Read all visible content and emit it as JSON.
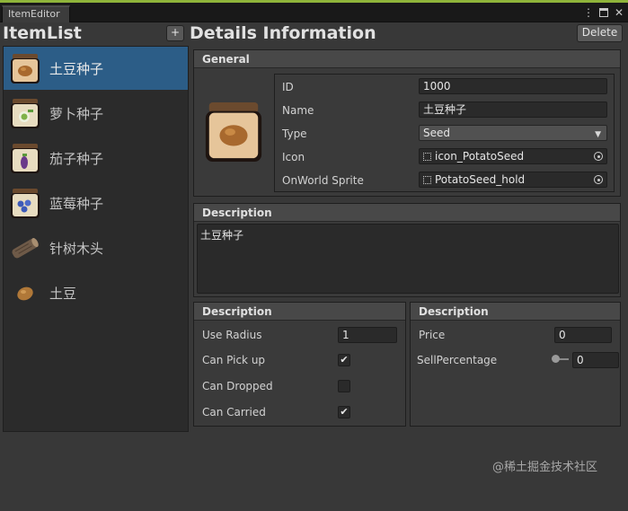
{
  "window": {
    "tab_title": "ItemEditor"
  },
  "header": {
    "list_title": "ItemList",
    "add_label": "+",
    "details_title": "Details Information",
    "delete_label": "Delete"
  },
  "items": [
    {
      "name": "土豆种子",
      "icon": "potato-seed-bag-icon"
    },
    {
      "name": "萝卜种子",
      "icon": "radish-seed-bag-icon"
    },
    {
      "name": "茄子种子",
      "icon": "eggplant-seed-bag-icon"
    },
    {
      "name": "蓝莓种子",
      "icon": "blueberry-seed-bag-icon"
    },
    {
      "name": "针树木头",
      "icon": "log-icon"
    },
    {
      "name": "土豆",
      "icon": "potato-icon"
    }
  ],
  "general": {
    "header": "General",
    "id_label": "ID",
    "id_value": "1000",
    "name_label": "Name",
    "name_value": "土豆种子",
    "type_label": "Type",
    "type_value": "Seed",
    "icon_label": "Icon",
    "icon_value": "icon_PotatoSeed",
    "sprite_label": "OnWorld Sprite",
    "sprite_value": "PotatoSeed_hold"
  },
  "description": {
    "header": "Description",
    "text": "土豆种子"
  },
  "props_left": {
    "header": "Description",
    "use_radius_label": "Use Radius",
    "use_radius_value": "1",
    "can_pickup_label": "Can Pick up",
    "can_dropped_label": "Can Dropped",
    "can_carried_label": "Can Carried",
    "checks": {
      "can_pickup": true,
      "can_dropped": false,
      "can_carried": true
    }
  },
  "props_right": {
    "header": "Description",
    "price_label": "Price",
    "price_value": "0",
    "sell_label": "SellPercentage",
    "sell_value": "0"
  },
  "watermark": "@稀土掘金技术社区",
  "colors": {
    "accent_selected": "#2c5d87",
    "top_line": "#8fb43a"
  }
}
